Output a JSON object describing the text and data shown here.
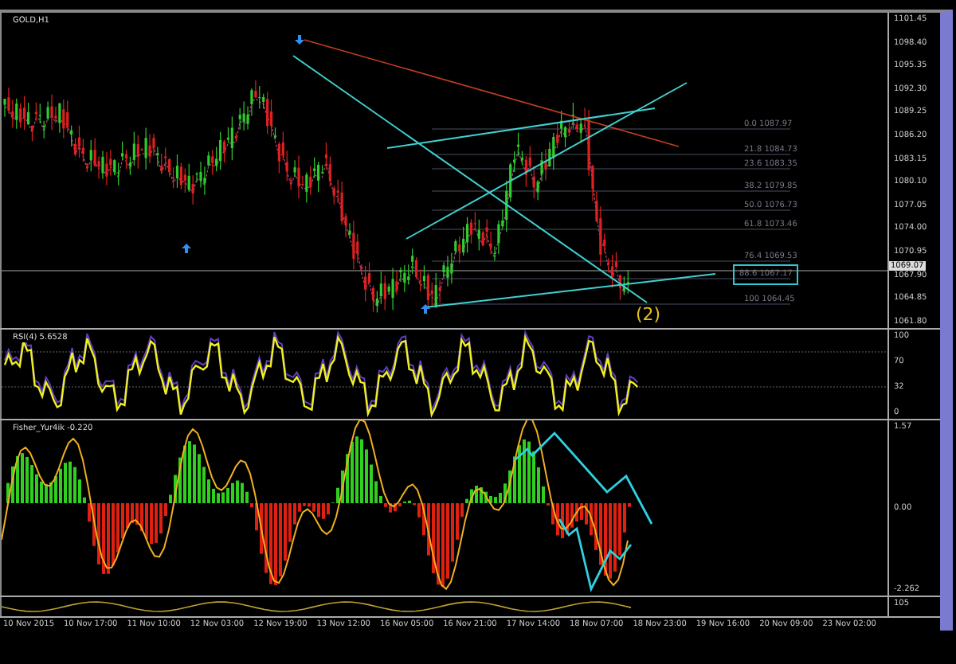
{
  "main_chart": {
    "title": "GOLD,H1",
    "price_axis": [
      "1101.45",
      "1098.40",
      "1095.35",
      "1092.30",
      "1089.25",
      "1086.20",
      "1083.15",
      "1080.10",
      "1077.05",
      "1074.00",
      "1070.95",
      "1067.90",
      "1064.85",
      "1061.80"
    ],
    "current_price": "1069.07",
    "fib_levels": [
      {
        "label": "0.0 1087.97",
        "selected": false
      },
      {
        "label": "21.8 1084.73",
        "selected": false
      },
      {
        "label": "23.6 1083.35",
        "selected": false
      },
      {
        "label": "38.2 1079.85",
        "selected": false
      },
      {
        "label": "50.0 1076.73",
        "selected": false
      },
      {
        "label": "61.8 1073.46",
        "selected": false
      },
      {
        "label": "76.4 1069.53",
        "selected": false
      },
      {
        "label": "88.6 1067.17",
        "selected": true
      },
      {
        "label": "100 1064.45",
        "selected": false
      }
    ],
    "wave_label": "(2)"
  },
  "rsi_panel": {
    "title": "RSI(4) 5.6528",
    "scale": [
      "100",
      "70",
      "32",
      "0"
    ]
  },
  "fisher_panel": {
    "title": "Fisher_Yur4ik -0.220",
    "scale": [
      "1.57",
      "0.00",
      "-2.262"
    ]
  },
  "bottom_panel": {
    "scale": [
      "105"
    ]
  },
  "time_axis": [
    "10 Nov 2015",
    "10 Nov 17:00",
    "11 Nov 10:00",
    "12 Nov 03:00",
    "12 Nov 19:00",
    "13 Nov 12:00",
    "16 Nov 05:00",
    "16 Nov 21:00",
    "17 Nov 14:00",
    "18 Nov 07:00",
    "18 Nov 23:00",
    "19 Nov 16:00",
    "20 Nov 09:00",
    "23 Nov 02:00"
  ]
}
